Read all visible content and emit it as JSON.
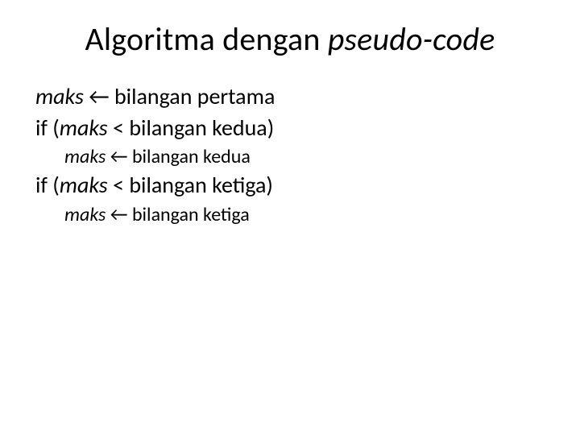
{
  "title": {
    "part1": "Algoritma dengan ",
    "part2_italic": "pseudo-code"
  },
  "code": {
    "l1": {
      "maks": "maks",
      "arrow": " ← ",
      "rest": "bilangan pertama"
    },
    "l2": {
      "if": "if (",
      "maks": "maks",
      "rest": " < bilangan kedua)"
    },
    "l3": {
      "maks": "maks",
      "arrow": " ← ",
      "rest": "bilangan kedua"
    },
    "l4": {
      "if": "if (",
      "maks": "maks",
      "rest": " < bilangan ketiga)"
    },
    "l5": {
      "maks": "maks",
      "arrow": " ← ",
      "rest": "bilangan ketiga"
    }
  }
}
